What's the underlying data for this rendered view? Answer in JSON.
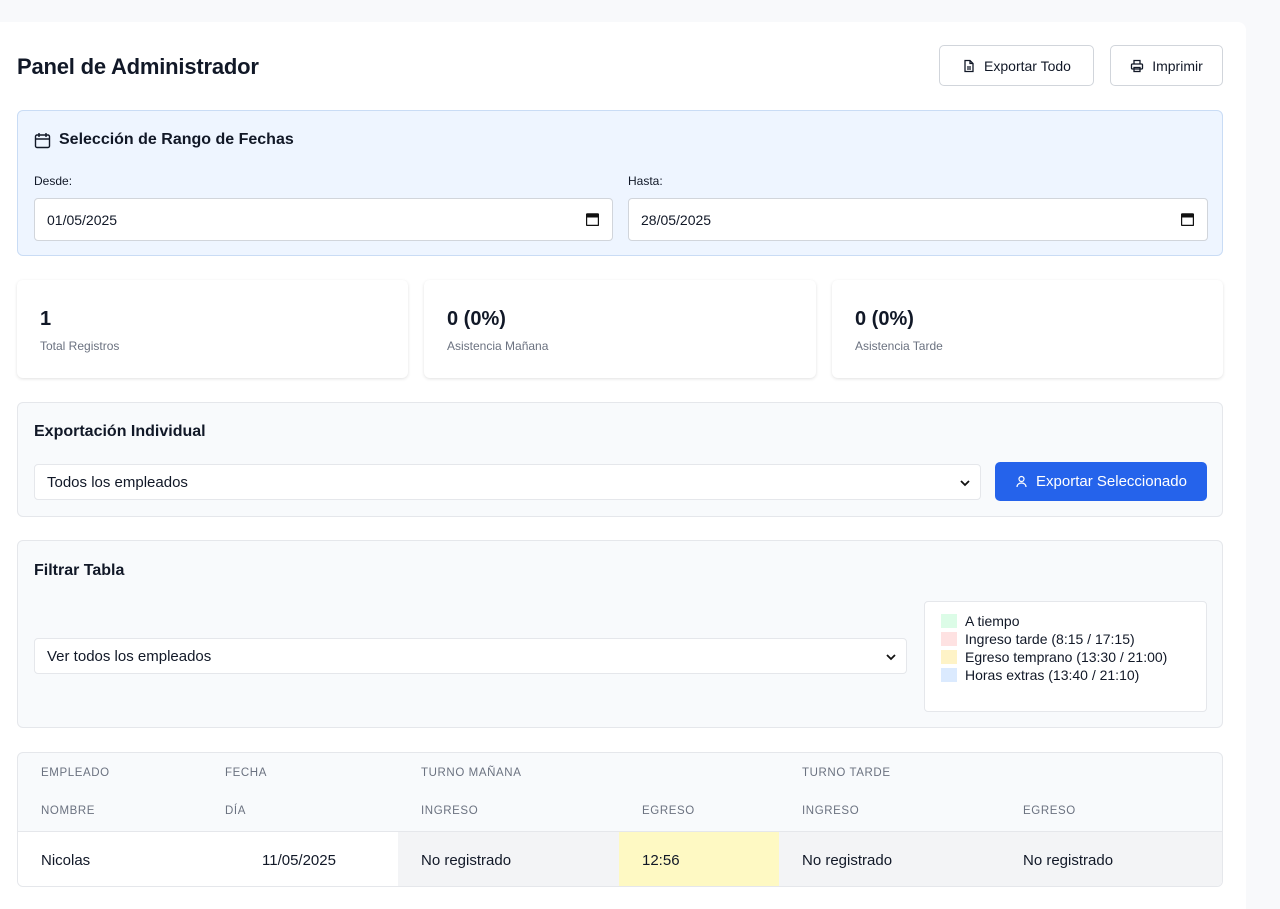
{
  "header": {
    "title": "Panel de Administrador",
    "export_all_label": "Exportar Todo",
    "print_label": "Imprimir"
  },
  "date_range": {
    "title": "Selección de Rango de Fechas",
    "from_label": "Desde:",
    "from_value": "01/05/2025",
    "to_label": "Hasta:",
    "to_value": "28/05/2025"
  },
  "stats": [
    {
      "value": "1",
      "label": "Total Registros"
    },
    {
      "value": "0 (0%)",
      "label": "Asistencia Mañana"
    },
    {
      "value": "0 (0%)",
      "label": "Asistencia Tarde"
    }
  ],
  "individual_export": {
    "title": "Exportación Individual",
    "select_value": "Todos los empleados",
    "button_label": "Exportar Seleccionado"
  },
  "filter": {
    "title": "Filtrar Tabla",
    "select_value": "Ver todos los empleados",
    "legend": [
      {
        "label": "A tiempo",
        "color": "#dcfce7"
      },
      {
        "label": "Ingreso tarde (8:15 / 17:15)",
        "color": "#fee2e2"
      },
      {
        "label": "Egreso temprano (13:30 / 21:00)",
        "color": "#fef3c7"
      },
      {
        "label": "Horas extras (13:40 / 21:10)",
        "color": "#dbeafe"
      }
    ]
  },
  "table": {
    "group_headers": [
      "EMPLEADO",
      "FECHA",
      "TURNO MAÑANA",
      "TURNO TARDE"
    ],
    "sub_headers": [
      "NOMBRE",
      "DÍA",
      "INGRESO",
      "EGRESO",
      "INGRESO",
      "EGRESO"
    ],
    "rows": [
      [
        "Nicolas",
        "11/05/2025",
        "No registrado",
        "12:56",
        "No registrado",
        "No registrado"
      ]
    ]
  },
  "colors": {
    "primary": "#2563eb",
    "date_card_bg": "#eef5ff",
    "cell_yellow": "#fef9c3",
    "cell_gray": "#f3f4f6"
  }
}
